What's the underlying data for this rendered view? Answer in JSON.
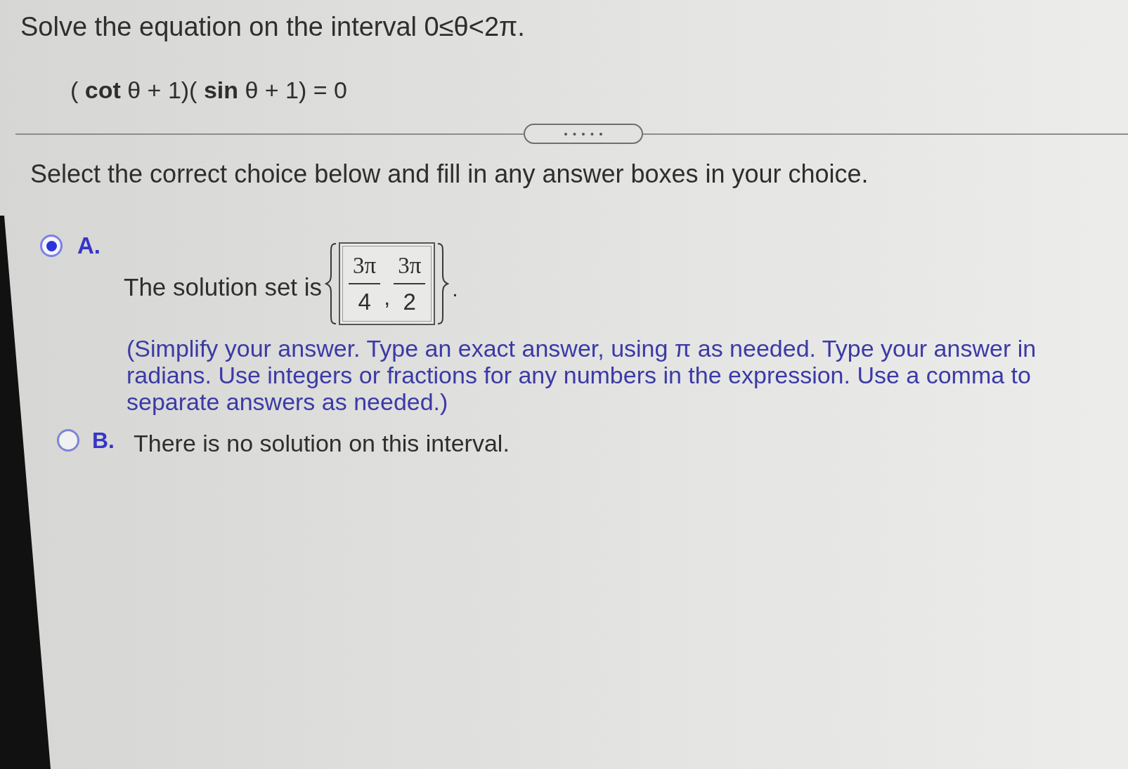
{
  "problem": {
    "prompt": "Solve the equation on the interval 0≤θ<2π.",
    "equation": "( **cot** θ + 1)( **sin** θ + 1) = 0"
  },
  "instruction": "Select the correct choice below and fill in any answer boxes in your choice.",
  "choices": [
    {
      "kind": "answer_set",
      "letter": "A.",
      "selected": true,
      "lead": "The solution set is",
      "answers": [
        {
          "numerator": "3π",
          "denominator": "4"
        },
        {
          "numerator": "3π",
          "denominator": "2"
        }
      ],
      "separator": ",",
      "trail": ".",
      "note": "(Simplify your answer. Type an exact answer, using π as needed. Type your answer in radians. Use integers or fractions for any numbers in the expression. Use a comma to separate answers as needed.)"
    },
    {
      "kind": "text",
      "letter": "B.",
      "selected": false,
      "text": "There is no solution on this interval."
    }
  ]
}
